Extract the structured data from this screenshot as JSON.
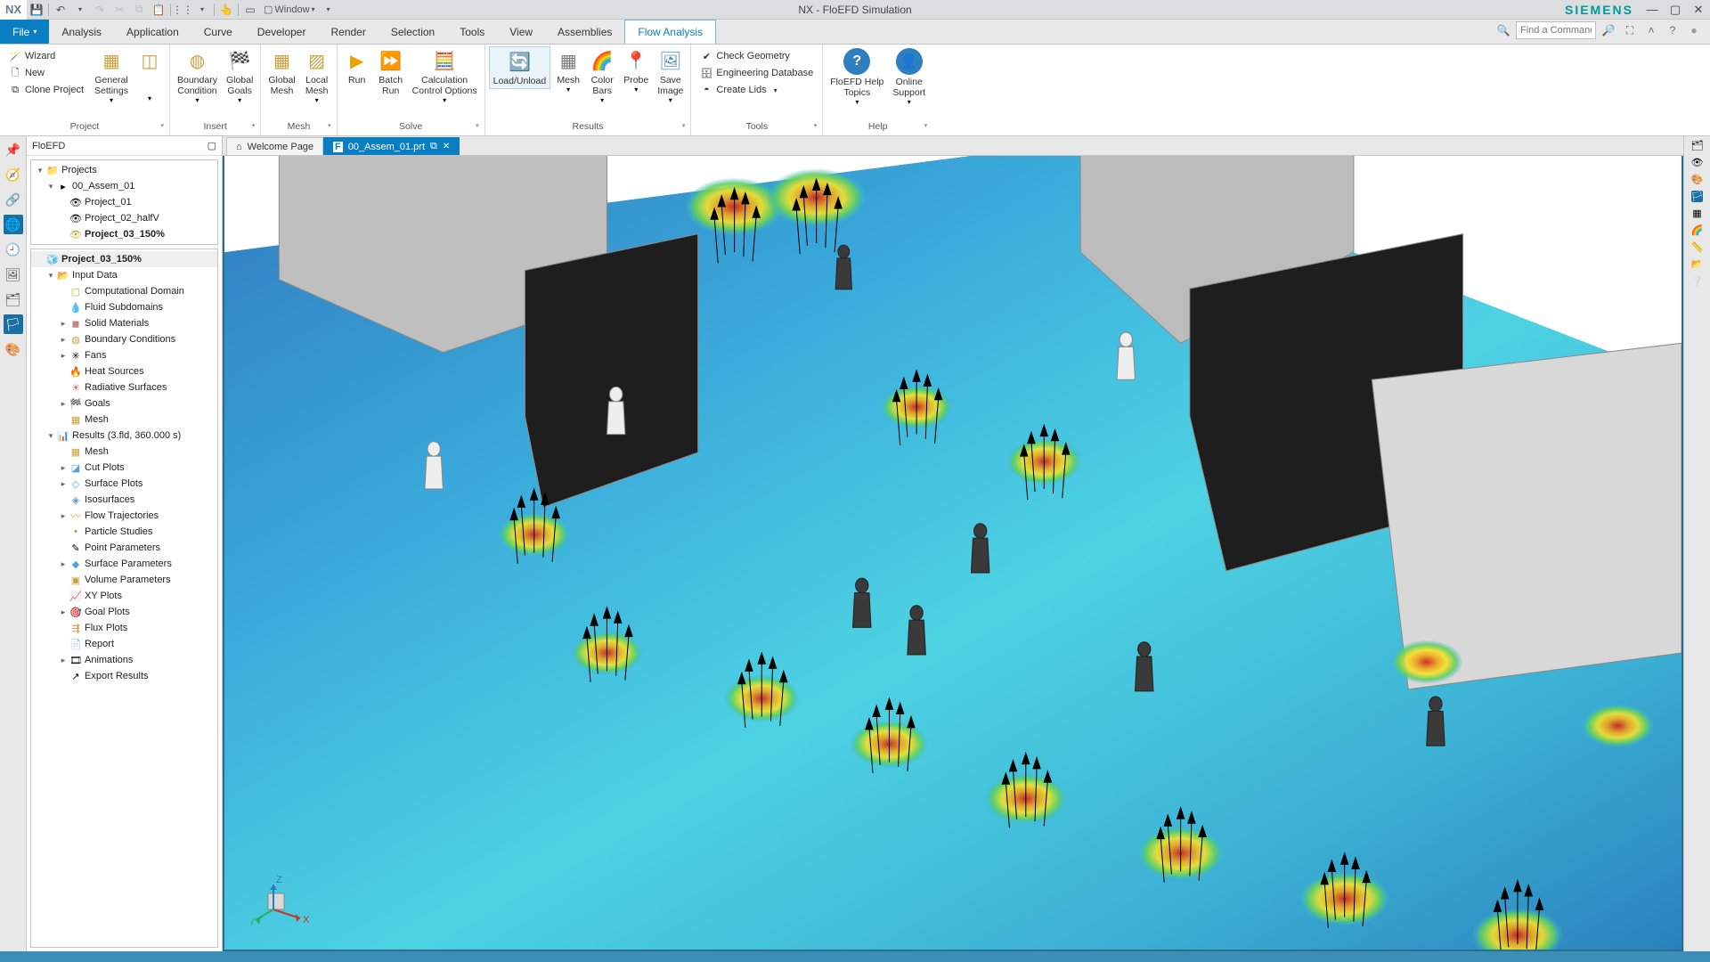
{
  "app": {
    "title": "NX - FloEFD Simulation",
    "logo": "NX",
    "brand": "SIEMENS"
  },
  "quickAccess": {
    "window_label": "Window",
    "icons": [
      "save-icon",
      "undo-icon",
      "redo-icon",
      "cut-icon",
      "copy-icon",
      "paste-icon",
      "grip-icon",
      "tune-icon",
      "link-icon"
    ]
  },
  "searchPlaceholder": "Find a Command",
  "menuTabs": {
    "file": "File",
    "analysis": "Analysis",
    "application": "Application",
    "curve": "Curve",
    "developer": "Developer",
    "render": "Render",
    "selection": "Selection",
    "tools": "Tools",
    "view": "View",
    "assemblies": "Assemblies",
    "flow": "Flow Analysis"
  },
  "ribbon": {
    "project": {
      "label": "Project",
      "wizard": "Wizard",
      "new": "New",
      "clone": "Clone Project",
      "general": "General\nSettings"
    },
    "insert": {
      "label": "Insert",
      "boundary": "Boundary\nCondition",
      "goals": "Global\nGoals"
    },
    "mesh": {
      "label": "Mesh",
      "global": "Global\nMesh",
      "local": "Local\nMesh"
    },
    "solve": {
      "label": "Solve",
      "run": "Run",
      "batch": "Batch\nRun",
      "calc": "Calculation\nControl Options"
    },
    "results": {
      "label": "Results",
      "load": "Load/Unload",
      "mesh": "Mesh",
      "color": "Color\nBars",
      "probe": "Probe",
      "save": "Save\nImage"
    },
    "tools": {
      "label": "Tools",
      "check": "Check Geometry",
      "engdb": "Engineering Database",
      "lids": "Create Lids"
    },
    "help": {
      "label": "Help",
      "topics": "FloEFD Help\nTopics",
      "support": "Online\nSupport"
    }
  },
  "sidepanel": {
    "title": "FloEFD",
    "projects": {
      "root": "Projects",
      "assem": "00_Assem_01",
      "p1": "Project_01",
      "p2": "Project_02_halfV",
      "p3": "Project_03_150%"
    },
    "tree": {
      "root": "Project_03_150%",
      "input": "Input Data",
      "comp": "Computational Domain",
      "fluid": "Fluid Subdomains",
      "solid": "Solid Materials",
      "bc": "Boundary Conditions",
      "fans": "Fans",
      "heat": "Heat Sources",
      "rad": "Radiative Surfaces",
      "goals": "Goals",
      "mesh": "Mesh",
      "results": "Results (3.fld, 360.000 s)",
      "rmesh": "Mesh",
      "cut": "Cut Plots",
      "surf": "Surface Plots",
      "iso": "Isosurfaces",
      "flow": "Flow Trajectories",
      "particle": "Particle Studies",
      "point": "Point Parameters",
      "surfparam": "Surface Parameters",
      "vol": "Volume Parameters",
      "xy": "XY Plots",
      "goalplots": "Goal Plots",
      "flux": "Flux Plots",
      "report": "Report",
      "anim": "Animations",
      "export": "Export Results"
    }
  },
  "docTabs": {
    "welcome": "Welcome Page",
    "file": "00_Assem_01.prt"
  },
  "triad": {
    "x": "X",
    "y": "Y",
    "z": "Z"
  }
}
